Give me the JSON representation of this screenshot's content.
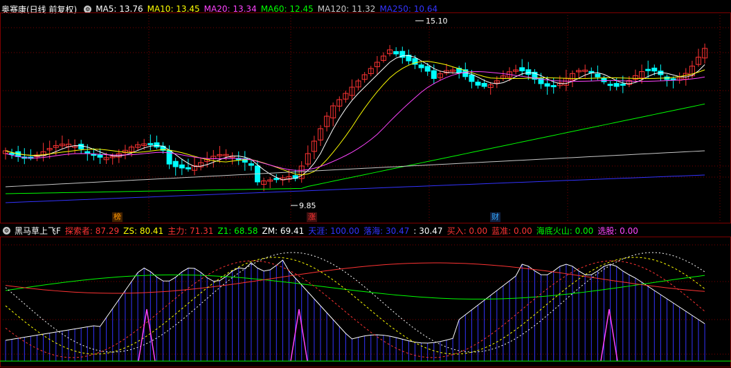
{
  "main_panel": {
    "title": "奥赛康(日线 前复权)",
    "indicators": [
      {
        "label": "MA5: 13.76",
        "color": "#ffffff"
      },
      {
        "label": "MA10: 13.45",
        "color": "#ffff00"
      },
      {
        "label": "MA20: 13.34",
        "color": "#ff44ff"
      },
      {
        "label": "MA60: 12.45",
        "color": "#00ff00"
      },
      {
        "label": "MA120: 11.32",
        "color": "#c8c8c8"
      },
      {
        "label": "MA250: 10.64",
        "color": "#3333ff"
      }
    ],
    "high_label": "15.10",
    "low_label": "9.85",
    "tags": [
      {
        "text": "榜",
        "color": "#ff9900",
        "bg": "#402000"
      },
      {
        "text": "涨",
        "color": "#ff3333",
        "bg": "#401010"
      },
      {
        "text": "财",
        "color": "#33aaff",
        "bg": "#102040"
      }
    ]
  },
  "sub_panel": {
    "title": "黑马草上飞F",
    "indicators": [
      {
        "label": "探索者: 87.29",
        "color": "#ff3333"
      },
      {
        "label": "ZS: 80.41",
        "color": "#ffff00"
      },
      {
        "label": "主力: 71.31",
        "color": "#ff3333"
      },
      {
        "label": "Z1: 68.58",
        "color": "#00ff00"
      },
      {
        "label": "ZM: 69.41",
        "color": "#ffffff"
      },
      {
        "label": "天涯: 100.00",
        "color": "#3333ff"
      },
      {
        "label": "落海: 30.47",
        "color": "#3333ff"
      },
      {
        "label": ": 30.47",
        "color": "#ffffff"
      },
      {
        "label": "买入: 0.00",
        "color": "#ff3333"
      },
      {
        "label": "蓝准: 0.00",
        "color": "#ff3333"
      },
      {
        "label": "海底火山: 0.00",
        "color": "#00ff00"
      },
      {
        "label": "选股: 0.00",
        "color": "#ff44ff"
      }
    ]
  },
  "colors": {
    "up": "#ff3333",
    "down": "#00ffff",
    "grid": "#800000"
  }
}
